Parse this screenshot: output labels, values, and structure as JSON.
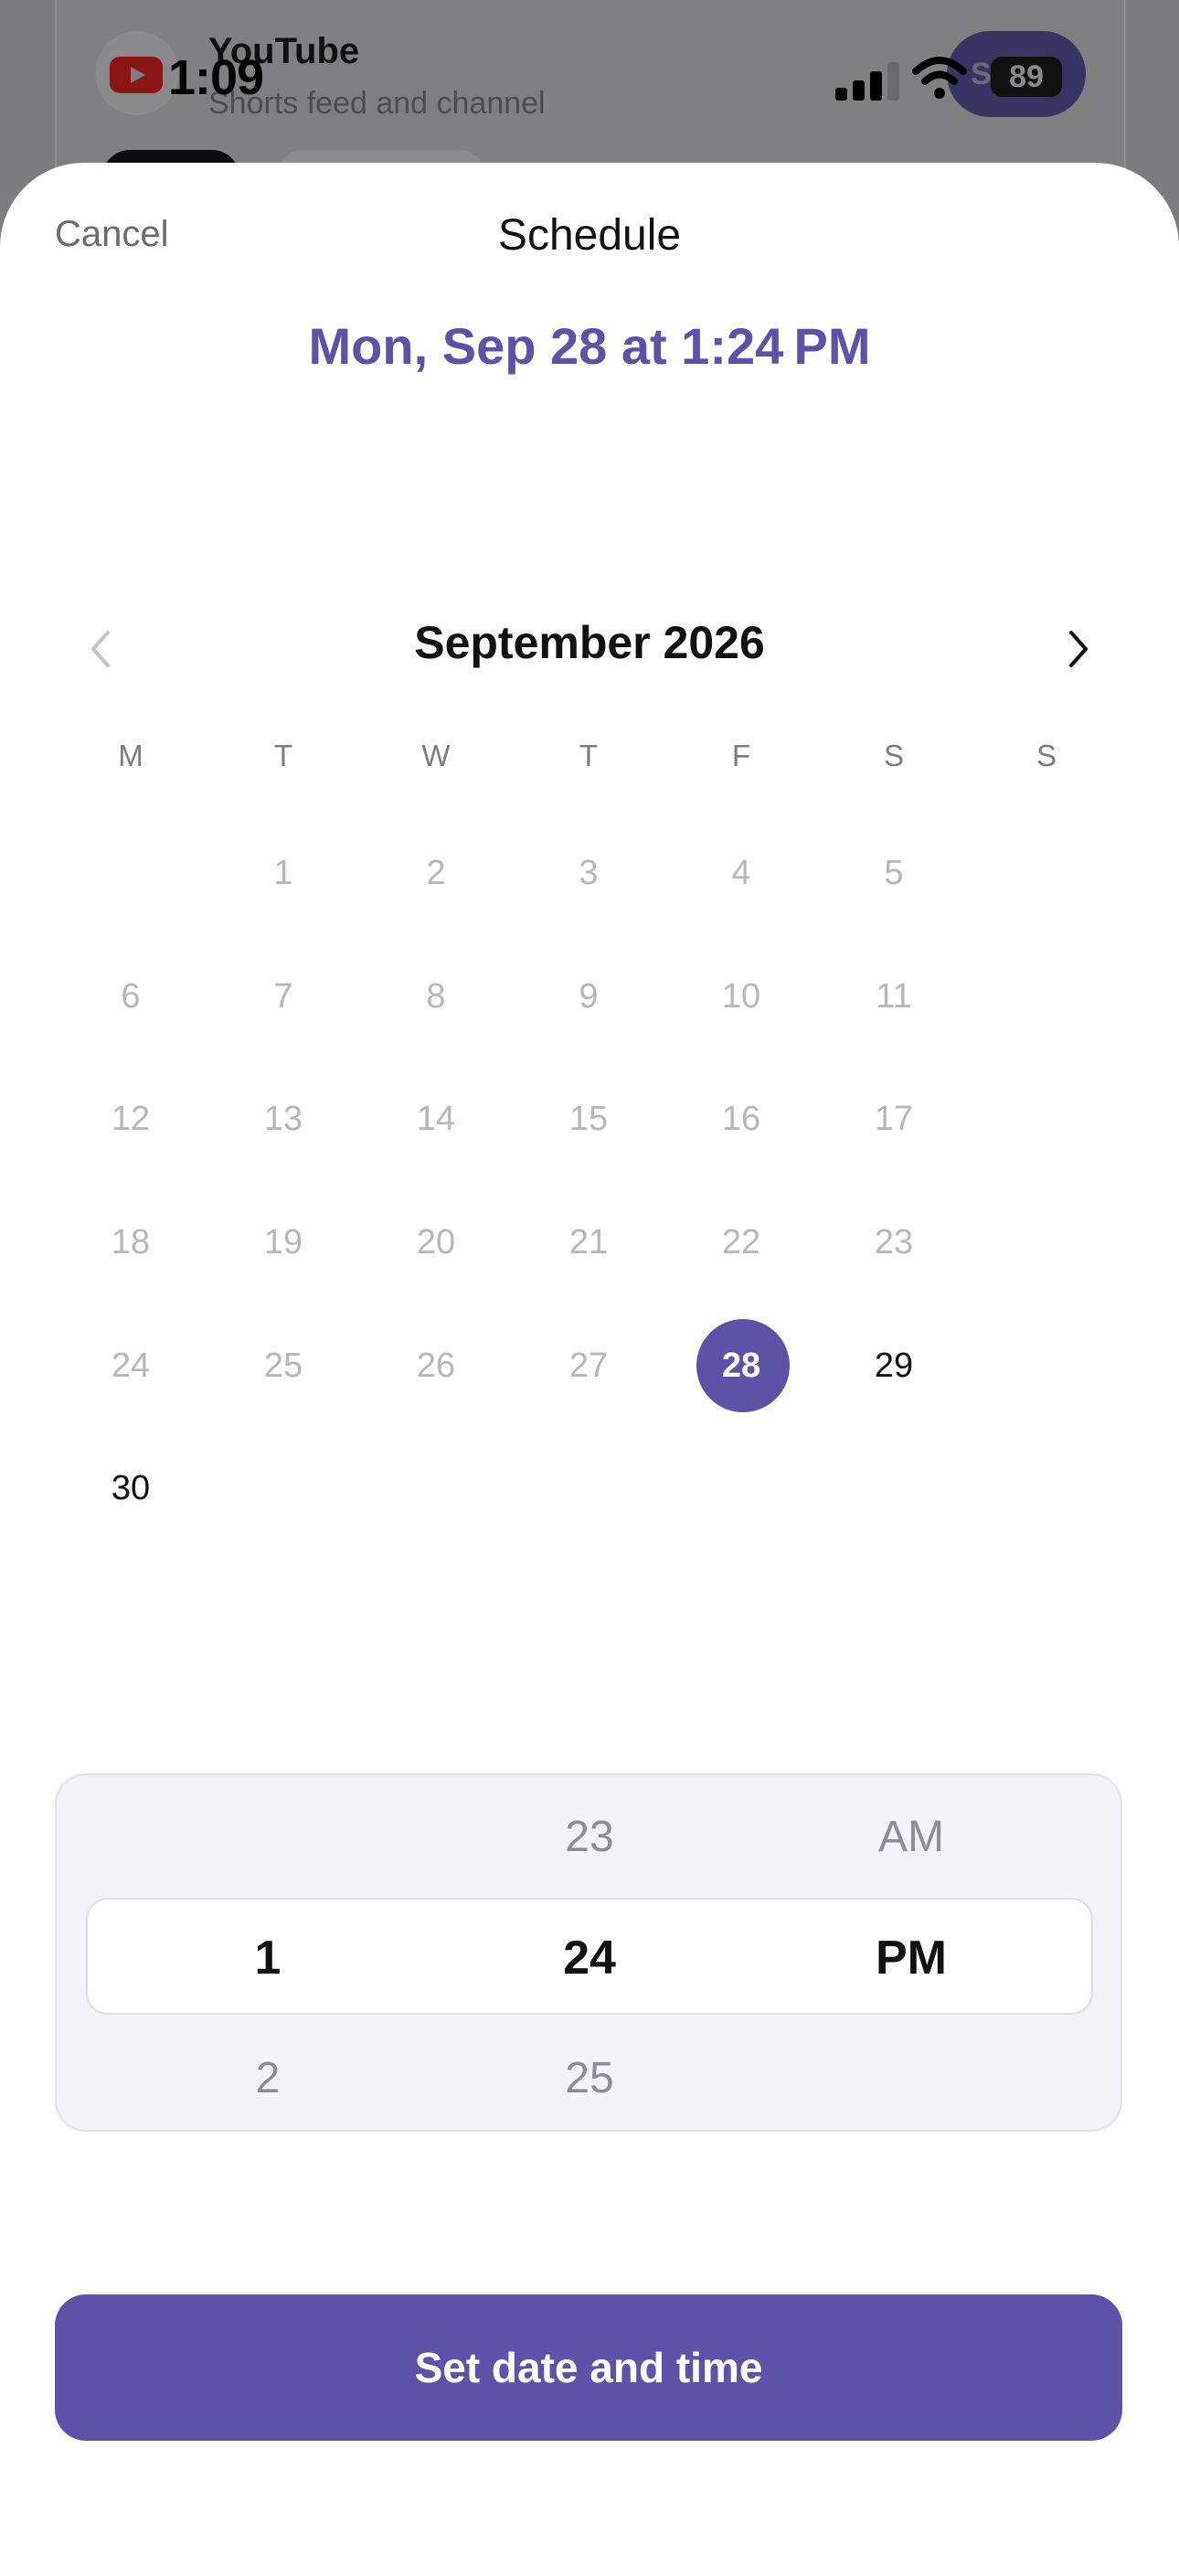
{
  "background_app": {
    "title": "YouTube",
    "subtitle": "Shorts feed and channel",
    "pill_label": "Sa"
  },
  "status_bar": {
    "time": "1:09",
    "battery": "89"
  },
  "sheet": {
    "cancel_label": "Cancel",
    "title": "Schedule",
    "selected_summary": "Mon, Sep 28 at 1:24 PM"
  },
  "calendar": {
    "month_label": "September 2026",
    "weekdays": [
      "M",
      "T",
      "W",
      "T",
      "F",
      "S",
      "S"
    ],
    "rows": [
      [
        "",
        "1",
        "2",
        "3",
        "4",
        "5",
        ""
      ],
      [
        "6",
        "7",
        "8",
        "9",
        "10",
        "11",
        ""
      ],
      [
        "12",
        "13",
        "14",
        "15",
        "16",
        "17",
        ""
      ],
      [
        "18",
        "19",
        "20",
        "21",
        "22",
        "23",
        ""
      ],
      [
        "24",
        "25",
        "26",
        "27",
        "28",
        "29",
        ""
      ],
      [
        "30",
        "",
        "",
        "",
        "",
        "",
        ""
      ]
    ],
    "selected_day": "28",
    "enabled_days": [
      "28",
      "29",
      "30"
    ]
  },
  "time_picker": {
    "hour": {
      "above": "",
      "current": "1",
      "below": "2"
    },
    "minute": {
      "above": "23",
      "current": "24",
      "below": "25"
    },
    "period": {
      "above": "AM",
      "current": "PM",
      "below": ""
    }
  },
  "confirm_button_label": "Set date and time",
  "colors": {
    "accent": "#5e51a8",
    "disabled_day": "#b6b6be"
  }
}
